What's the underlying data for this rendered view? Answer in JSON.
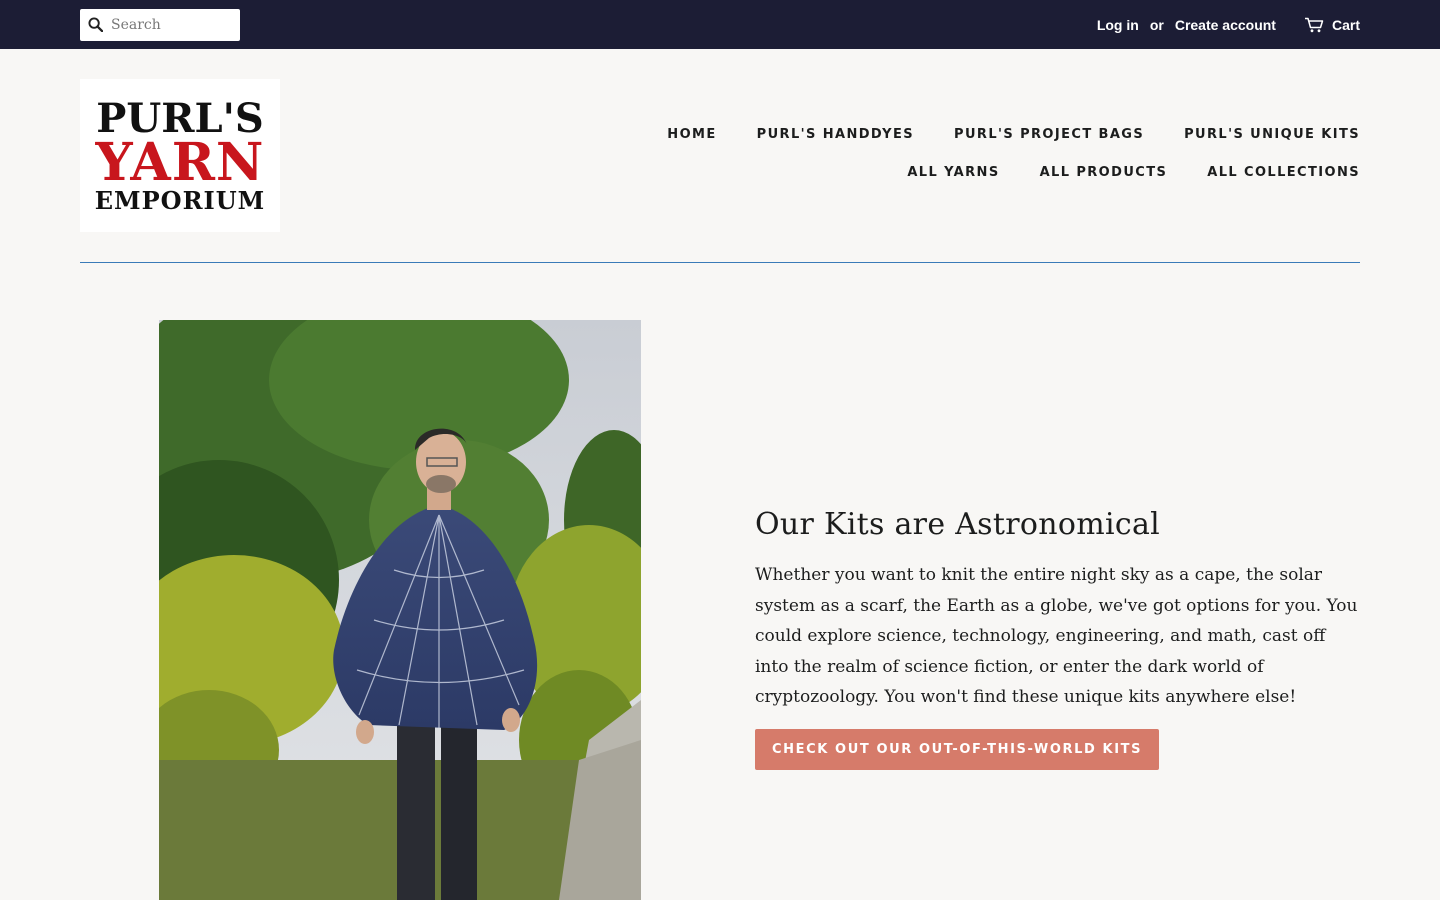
{
  "topbar": {
    "search_placeholder": "Search",
    "login_label": "Log in",
    "or_label": "or",
    "create_account_label": "Create account",
    "cart_label": "Cart"
  },
  "logo": {
    "line1": "PURL'S",
    "line2": "YARN",
    "line3": "EMPORIUM"
  },
  "nav": {
    "items": [
      {
        "label": "HOME"
      },
      {
        "label": "PURL'S HANDDYES"
      },
      {
        "label": "PURL'S PROJECT BAGS"
      },
      {
        "label": "PURL'S UNIQUE KITS"
      },
      {
        "label": "ALL YARNS"
      },
      {
        "label": "ALL PRODUCTS"
      },
      {
        "label": "ALL COLLECTIONS"
      }
    ]
  },
  "feature": {
    "heading": "Our Kits are Astronomical",
    "body": "Whether you want to knit the entire night sky as a cape, the solar system as a scarf, the Earth as a globe, we've got options for you. You could explore science, technology, engineering, and math, cast off into the realm of science fiction, or enter the dark world of cryptozoology. You won't find these unique kits anywhere else!",
    "cta_label": "CHECK OUT OUR OUT-OF-THIS-WORLD KITS"
  },
  "colors": {
    "topbar_bg": "#1c1d35",
    "page_bg": "#f8f7f5",
    "accent_button": "#d67b6a",
    "rule": "#3a7bb8",
    "logo_red": "#c8161d"
  },
  "icons": {
    "search": "search-icon",
    "cart": "cart-icon"
  }
}
